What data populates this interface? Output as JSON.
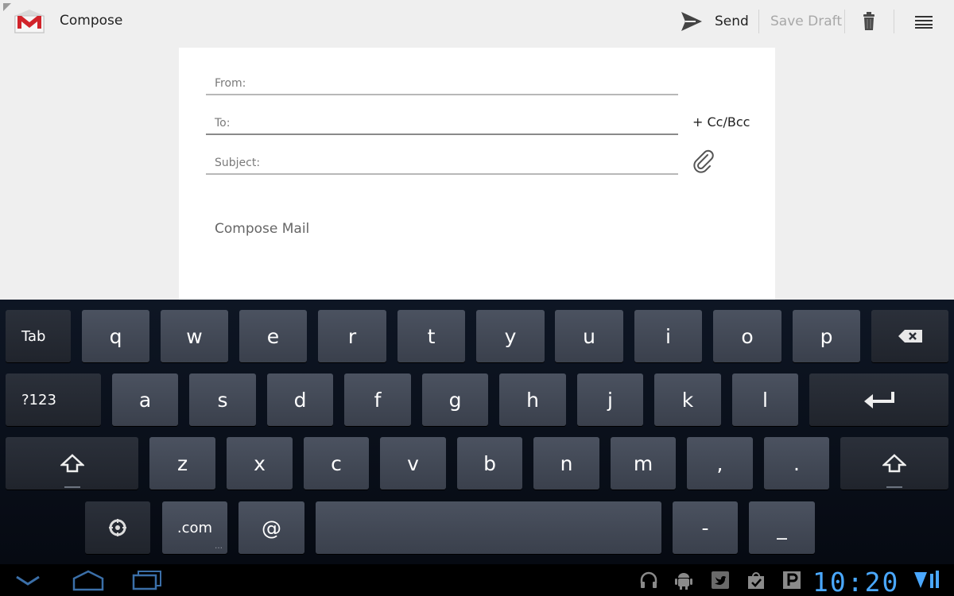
{
  "actionbar": {
    "title": "Compose",
    "send_label": "Send",
    "save_draft_label": "Save Draft",
    "icons": [
      "gmail-icon",
      "send-icon",
      "trash-icon",
      "overflow-menu-icon"
    ]
  },
  "compose": {
    "from_label": "From:",
    "to_label": "To:",
    "subject_label": "Subject:",
    "cc_bcc_label": "+ Cc/Bcc",
    "body_placeholder": "Compose Mail",
    "icons": [
      "attachment-icon"
    ]
  },
  "keyboard": {
    "row1": [
      "Tab",
      "q",
      "w",
      "e",
      "r",
      "t",
      "y",
      "u",
      "i",
      "o",
      "p"
    ],
    "row2": [
      "?123",
      "a",
      "s",
      "d",
      "f",
      "g",
      "h",
      "j",
      "k",
      "l"
    ],
    "row3": [
      "z",
      "x",
      "c",
      "v",
      "b",
      "n",
      "m",
      ",",
      "."
    ],
    "row4": [
      ".com",
      "@",
      "-",
      "_"
    ],
    "icons": [
      "backspace-icon",
      "enter-icon",
      "shift-icon",
      "settings-icon"
    ]
  },
  "systembar": {
    "clock": "10:20",
    "colors": {
      "clock": "#4aa8ff"
    },
    "icons": [
      "back-icon",
      "home-icon",
      "recent-apps-icon",
      "headphones-icon",
      "android-icon",
      "twitter-icon",
      "shopping-bag-icon",
      "p-app-icon",
      "signal-icon"
    ]
  }
}
